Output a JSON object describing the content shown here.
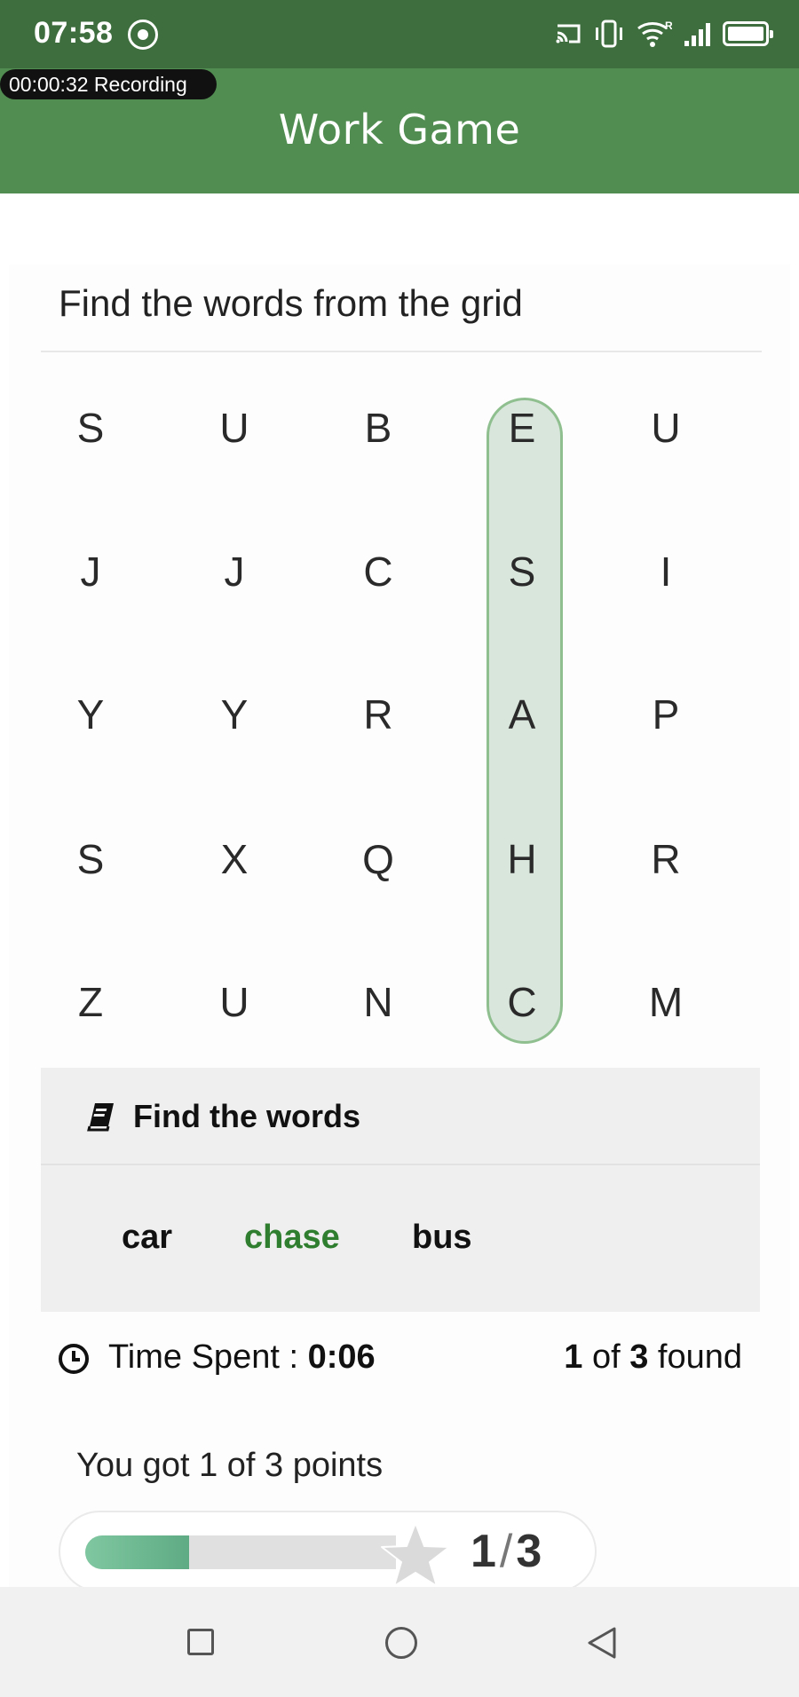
{
  "status_bar": {
    "time": "07:58",
    "icons": [
      "record-indicator-icon",
      "cast-icon",
      "vibrate-icon",
      "wifi-icon",
      "signal-icon",
      "battery-icon"
    ]
  },
  "recording_badge": "00:00:32  Recording",
  "app": {
    "title": "Work Game",
    "accent_color": "#518d51",
    "found_word_color": "#2f7d2f"
  },
  "puzzle": {
    "instruction": "Find the words from the grid",
    "grid": [
      [
        "S",
        "U",
        "B",
        "E",
        "U"
      ],
      [
        "J",
        "J",
        "C",
        "S",
        "I"
      ],
      [
        "Y",
        "Y",
        "R",
        "A",
        "P"
      ],
      [
        "S",
        "X",
        "Q",
        "H",
        "R"
      ],
      [
        "Z",
        "U",
        "N",
        "C",
        "M"
      ]
    ],
    "highlighted_column": 3
  },
  "words_panel": {
    "title": "Find the words",
    "icon": "book-icon",
    "words": [
      {
        "text": "car",
        "found": false
      },
      {
        "text": "chase",
        "found": true
      },
      {
        "text": "bus",
        "found": false
      }
    ]
  },
  "stats": {
    "time_label": "Time Spent : ",
    "time_value": "0:06",
    "found_count": "1",
    "of_label": " of ",
    "total_count": "3",
    "found_label": " found"
  },
  "score": {
    "text": "You got 1 of 3 points",
    "current": "1",
    "separator": "/",
    "total": "3",
    "progress": 0.333
  },
  "nav": {
    "icons": [
      "recents-square-icon",
      "home-circle-icon",
      "back-triangle-icon"
    ]
  }
}
